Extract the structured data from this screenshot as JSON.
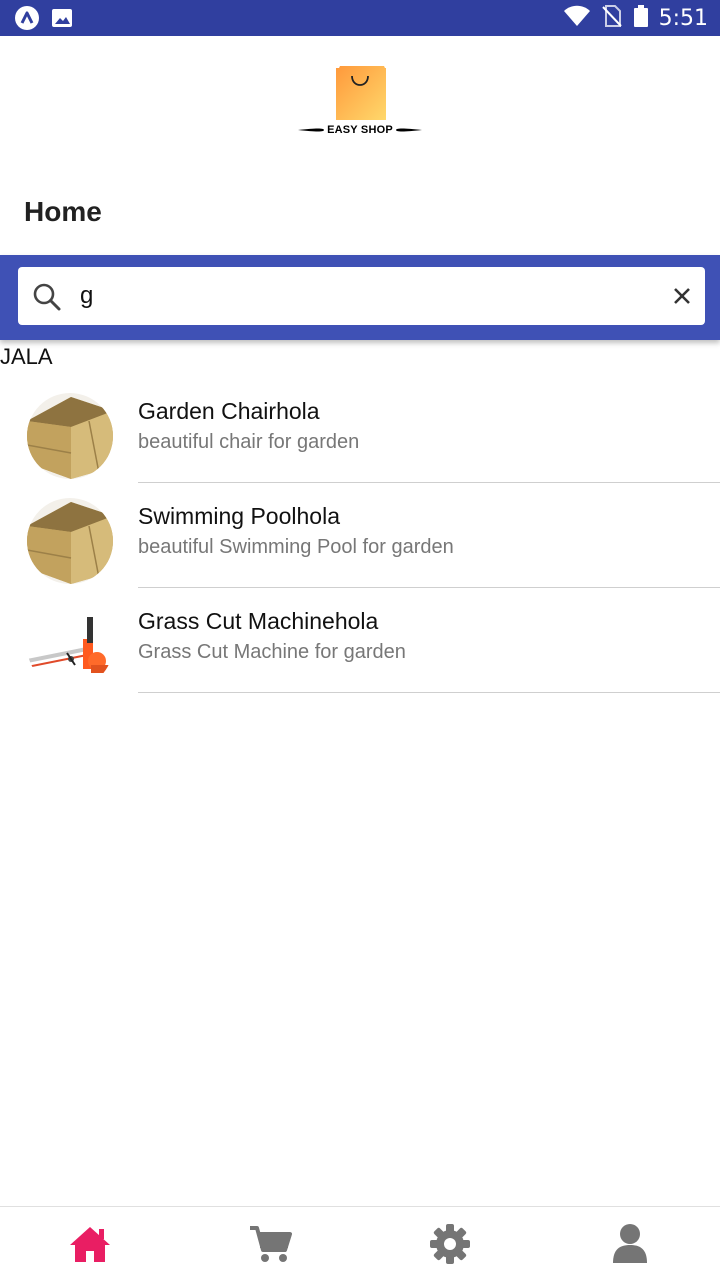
{
  "status_bar": {
    "time": "5:51",
    "left_icons": [
      "app-launcher-icon",
      "image-icon"
    ],
    "right_icons": [
      "wifi-icon",
      "no-sim-icon",
      "battery-icon"
    ]
  },
  "header": {
    "logo_text": "EASY SHOP",
    "title": "Home"
  },
  "search": {
    "value": "g",
    "placeholder": ""
  },
  "section": {
    "label": "JALA"
  },
  "products": [
    {
      "title": "Garden Chairhola",
      "subtitle": "beautiful chair for garden",
      "image": "cardboard-box"
    },
    {
      "title": "Swimming Poolhola",
      "subtitle": "beautiful Swimming Pool for garden",
      "image": "cardboard-box"
    },
    {
      "title": "Grass Cut Machinehola",
      "subtitle": "Grass Cut Machine for garden",
      "image": "grass-cutter"
    }
  ],
  "bottom_nav": {
    "tabs": [
      "home-icon",
      "cart-icon",
      "settings-icon",
      "user-icon"
    ],
    "active": "home-icon"
  },
  "colors": {
    "status_bar": "#303f9f",
    "primary": "#3f51b5",
    "active_tab": "#e91e63",
    "inactive_tab": "#757575",
    "subtitle": "#777777"
  }
}
